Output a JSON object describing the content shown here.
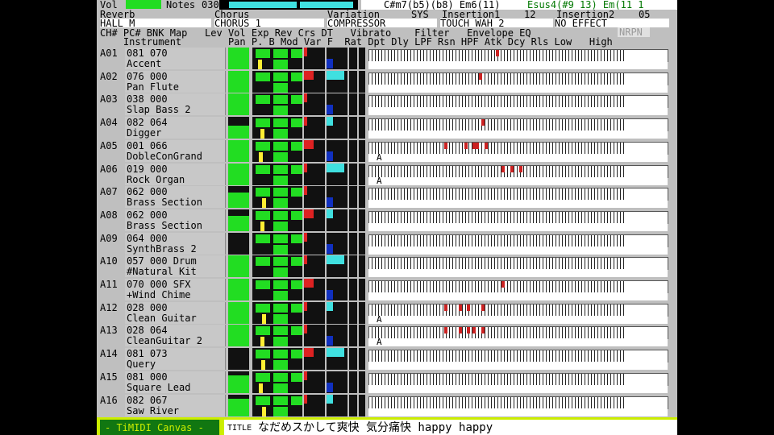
{
  "top": {
    "vol_label": "Vol",
    "notes_label": "Notes",
    "notes_value": "030",
    "chord_main": "C#m7(b5)(b8) Em6(11)",
    "chord_alt": "Esus4(#9 13) Em(11 1",
    "effects_labels": [
      "Reverb",
      "Chorus",
      "Variation",
      "SYS",
      "Insertion1",
      "Insertion2"
    ],
    "insertion1_num": "12",
    "insertion2_num": "05",
    "reverb": "HALL M",
    "chorus": "CHORUS 1",
    "variation": "COMPRESSOR",
    "insertion1": "TOUCH WAH 2",
    "insertion2": "NO EFFECT"
  },
  "columns": {
    "line1": "CH# PC# BNK Map   Lev Vol Exp Rev Crs DT   Vibrato    Filter   Envelope EQ",
    "line2": "    Instrument        Pan P. B Mod Var F  Rat Dpt Dly LPF Rsn HPF Atk Dcy Rls Low   High",
    "nrpn": "NRPN"
  },
  "channels": [
    {
      "ch": "A01",
      "l1": "081 070",
      "l2": "Accent",
      "lev": 100,
      "pan": 20,
      "pancolor": "yellow",
      "notes": [
        68
      ],
      "acc": ""
    },
    {
      "ch": "A02",
      "l1": "076 000",
      "l2": "Pan Flute",
      "lev": 100,
      "pan": 50,
      "pancolor": "none",
      "notes": [
        62
      ],
      "acc": ""
    },
    {
      "ch": "A03",
      "l1": "038 000",
      "l2": "Slap Bass 2",
      "lev": 100,
      "pan": 50,
      "pancolor": "none",
      "notes": [],
      "acc": ""
    },
    {
      "ch": "A04",
      "l1": "082 064",
      "l2": "Digger",
      "lev": 60,
      "pan": 40,
      "pancolor": "yellow",
      "notes": [
        63
      ],
      "acc": ""
    },
    {
      "ch": "A05",
      "l1": "001 066",
      "l2": "DobleConGrand",
      "lev": 100,
      "pan": 25,
      "pancolor": "yellow",
      "notes": [
        50,
        57,
        60,
        61,
        64
      ],
      "acc": "A"
    },
    {
      "ch": "A06",
      "l1": "019 000",
      "l2": "Rock Organ",
      "lev": 100,
      "pan": 50,
      "pancolor": "none",
      "notes": [
        70,
        73,
        76
      ],
      "acc": "A"
    },
    {
      "ch": "A07",
      "l1": "062 000",
      "l2": "Brass Section",
      "lev": 70,
      "pan": 60,
      "pancolor": "yellow",
      "notes": [],
      "acc": ""
    },
    {
      "ch": "A08",
      "l1": "062 000",
      "l2": "Brass Section",
      "lev": 70,
      "pan": 40,
      "pancolor": "yellow",
      "notes": [],
      "acc": ""
    },
    {
      "ch": "A09",
      "l1": "064 000",
      "l2": "SynthBrass 2",
      "lev": 0,
      "pan": 50,
      "pancolor": "none",
      "notes": [],
      "acc": ""
    },
    {
      "ch": "A10",
      "l1": "057 000 Drum",
      "l2": "#Natural Kit",
      "lev": 100,
      "pan": 50,
      "pancolor": "none",
      "notes": [],
      "acc": ""
    },
    {
      "ch": "A11",
      "l1": "070 000 SFX",
      "l2": "+Wind Chime",
      "lev": 100,
      "pan": 50,
      "pancolor": "none",
      "notes": [
        70
      ],
      "acc": ""
    },
    {
      "ch": "A12",
      "l1": "028 000",
      "l2": "Clean Guitar",
      "lev": 100,
      "pan": 55,
      "pancolor": "yellow",
      "notes": [
        50,
        55,
        58,
        63
      ],
      "acc": "A"
    },
    {
      "ch": "A13",
      "l1": "028 064",
      "l2": "CleanGuitar 2",
      "lev": 100,
      "pan": 45,
      "pancolor": "yellow",
      "notes": [
        50,
        55,
        58,
        60,
        63
      ],
      "acc": "A"
    },
    {
      "ch": "A14",
      "l1": "081 073",
      "l2": "Query",
      "lev": 0,
      "pan": 50,
      "pancolor": "yellow",
      "notes": [],
      "acc": ""
    },
    {
      "ch": "A15",
      "l1": "081 000",
      "l2": "Square Lead",
      "lev": 80,
      "pan": 30,
      "pancolor": "yellow",
      "notes": [],
      "acc": ""
    },
    {
      "ch": "A16",
      "l1": "082 067",
      "l2": "Saw River",
      "lev": 80,
      "pan": 55,
      "pancolor": "yellow",
      "notes": [],
      "acc": ""
    }
  ],
  "status": {
    "brand": "- TiMIDI Canvas -",
    "title_label": "TITLE",
    "title": "なだめスかして爽快 気分痛快 happy happy"
  },
  "colors": {
    "green": "#22dd22",
    "cyan": "#40e0e0",
    "red": "#dd2222",
    "blue": "#1030c0",
    "status": "#ccee00"
  }
}
